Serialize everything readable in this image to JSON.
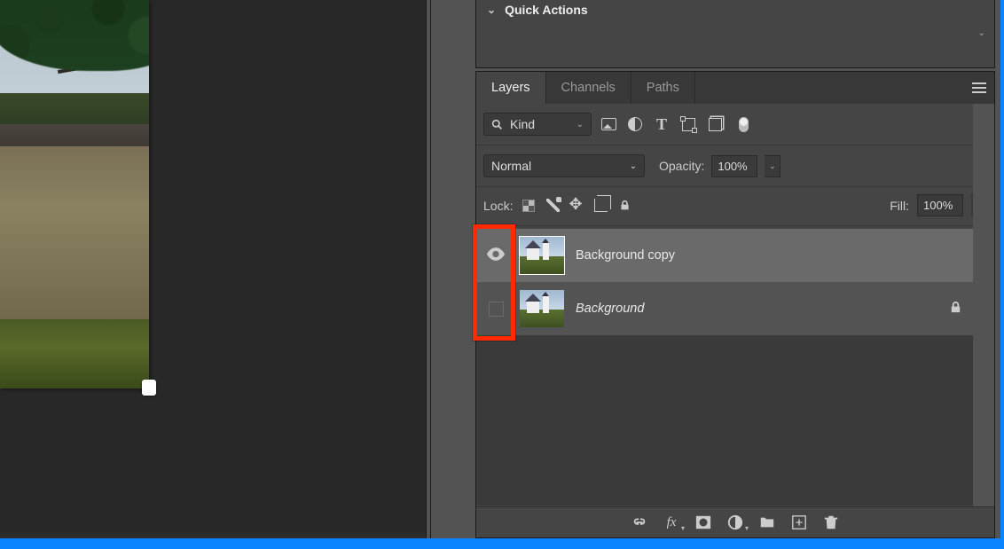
{
  "quickActions": {
    "title": "Quick Actions"
  },
  "tabs": {
    "layers": "Layers",
    "channels": "Channels",
    "paths": "Paths"
  },
  "filter": {
    "kind": "Kind"
  },
  "blend": {
    "mode": "Normal",
    "opacityLabel": "Opacity:",
    "opacityValue": "100%"
  },
  "lock": {
    "label": "Lock:",
    "fillLabel": "Fill:",
    "fillValue": "100%"
  },
  "layers": [
    {
      "name": "Background copy",
      "visible": true,
      "selected": true,
      "locked": false
    },
    {
      "name": "Background",
      "visible": false,
      "selected": false,
      "locked": true,
      "italic": true
    }
  ]
}
